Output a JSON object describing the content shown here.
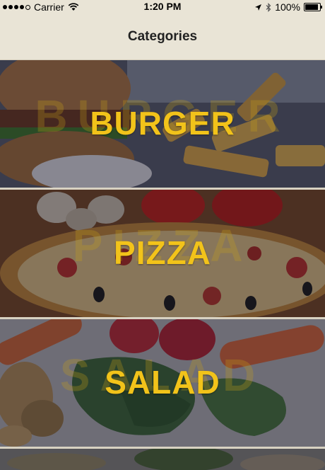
{
  "status_bar": {
    "carrier": "Carrier",
    "time": "1:20 PM",
    "battery_percent": "100%",
    "battery_level": 1.0,
    "signal_dots": 5,
    "signal_filled": 4,
    "icons": [
      "wifi-icon",
      "location-icon",
      "bluetooth-icon",
      "battery-icon"
    ]
  },
  "nav": {
    "title": "Categories"
  },
  "categories": [
    {
      "label": "BURGER"
    },
    {
      "label": "PIZZA"
    },
    {
      "label": "SALAD"
    }
  ],
  "colors": {
    "accent": "#f2c31a",
    "bar_background": "#e9e4d6"
  }
}
